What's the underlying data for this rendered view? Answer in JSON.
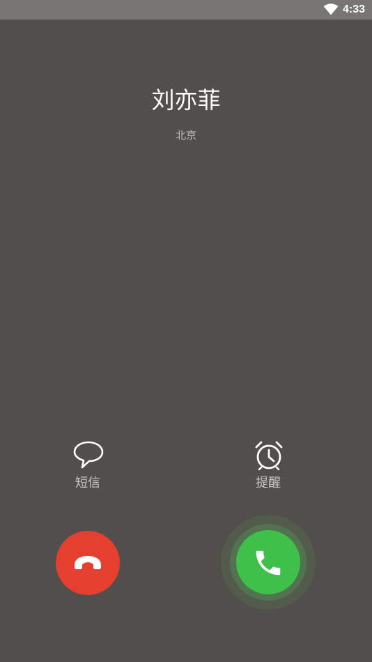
{
  "status_bar": {
    "time": "4:33",
    "icons": [
      "wifi-icon"
    ]
  },
  "call": {
    "caller_name": "刘亦菲",
    "caller_location": "北京"
  },
  "actions": {
    "sms_label": "短信",
    "sms_icon": "speech-bubble-icon",
    "remind_label": "提醒",
    "remind_icon": "alarm-clock-icon"
  },
  "buttons": {
    "decline_icon": "hang-up-icon",
    "decline_color": "#e53f2f",
    "answer_icon": "phone-icon",
    "answer_color": "#3ec04b"
  },
  "colors": {
    "background": "#524e4b",
    "status_bar": "#787674"
  }
}
